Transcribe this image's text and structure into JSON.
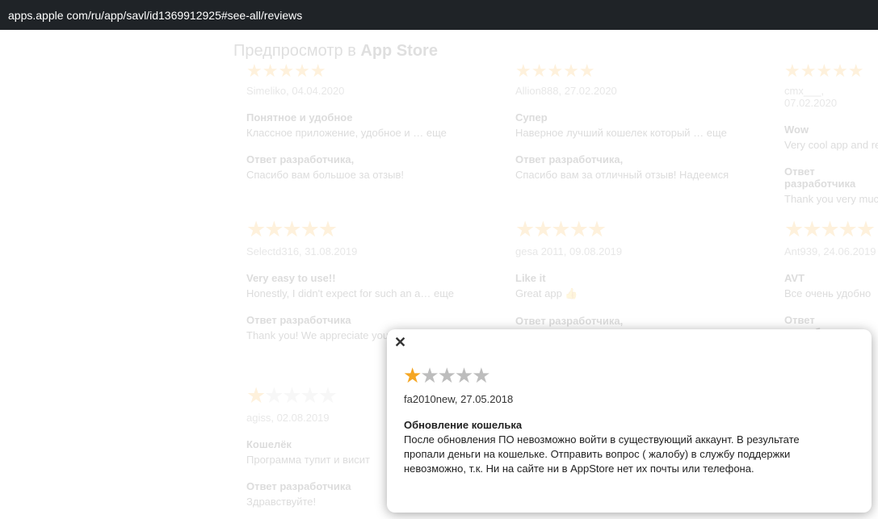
{
  "browser": {
    "url": "apps.apple com/ru/app/savl/id1369912925#see-all/reviews"
  },
  "page": {
    "preview_title_prefix": "Предпросмотр в ",
    "preview_title_bold": "App Store",
    "reviews": [
      {
        "stars": "★★★★★",
        "meta": "Simeliko, 04.04.2020",
        "title": "Понятное и удобное",
        "body": "Классное приложение, удобное и …   еще",
        "resp_title": "Ответ разработчика,",
        "resp": "Спасибо вам большое за отзыв!"
      },
      {
        "stars": "★★★★★",
        "meta": "Allion888, 27.02.2020",
        "title": "Супер",
        "body": "Наверное лучший кошелек который …   еще",
        "resp_title": "Ответ разработчика,",
        "resp": "Спасибо вам за отличный отзыв! Надеемся"
      },
      {
        "stars": "★★★★★",
        "meta": "cmx___, 07.02.2020",
        "title": "Wow",
        "body": "Very cool app and re",
        "resp_title": "Ответ разработчика",
        "resp": "Thank you very muc"
      },
      {
        "stars": "★★★★★",
        "meta": "Selectd316, 31.08.2019",
        "title": "Very easy to use!!",
        "body": "Honestly, I didn't expect for such an a…   еще",
        "resp_title": "Ответ разработчика",
        "resp": "Thank you! We appreciate your…"
      },
      {
        "stars": "★★★★★",
        "meta": "gesa 2011, 09.08.2019",
        "title": "Like it",
        "body": "Great app 👍",
        "resp_title": "Ответ разработчика,",
        "resp": ""
      },
      {
        "stars": "★★★★★",
        "meta": "Ant939, 24.06.2019",
        "title": "AVT",
        "body": "Все очень удобно",
        "resp_title": "Ответ разработчика",
        "resp": ""
      },
      {
        "stars_on": "★",
        "stars_off": "★★★★",
        "meta": "agiss, 02.08.2019",
        "title": "Кошелёк",
        "body": "Программа тупит и висит",
        "resp_title": "Ответ разработчика",
        "resp": "Здравствуйте!"
      }
    ]
  },
  "modal": {
    "close_label": "✕",
    "stars_on": "★",
    "stars_off": "★★★★",
    "meta": "fa2010new, 27.05.2018",
    "title": "Обновление кошелька",
    "body": "После обновления ПО невозможно войти в существующий аккаунт. В результате пропали деньги на кошельке. Отправить вопрос ( жалобу) в службу поддержки невозможно, т.к. Ни на сайте ни в AppStore нет их почты или телефона."
  }
}
